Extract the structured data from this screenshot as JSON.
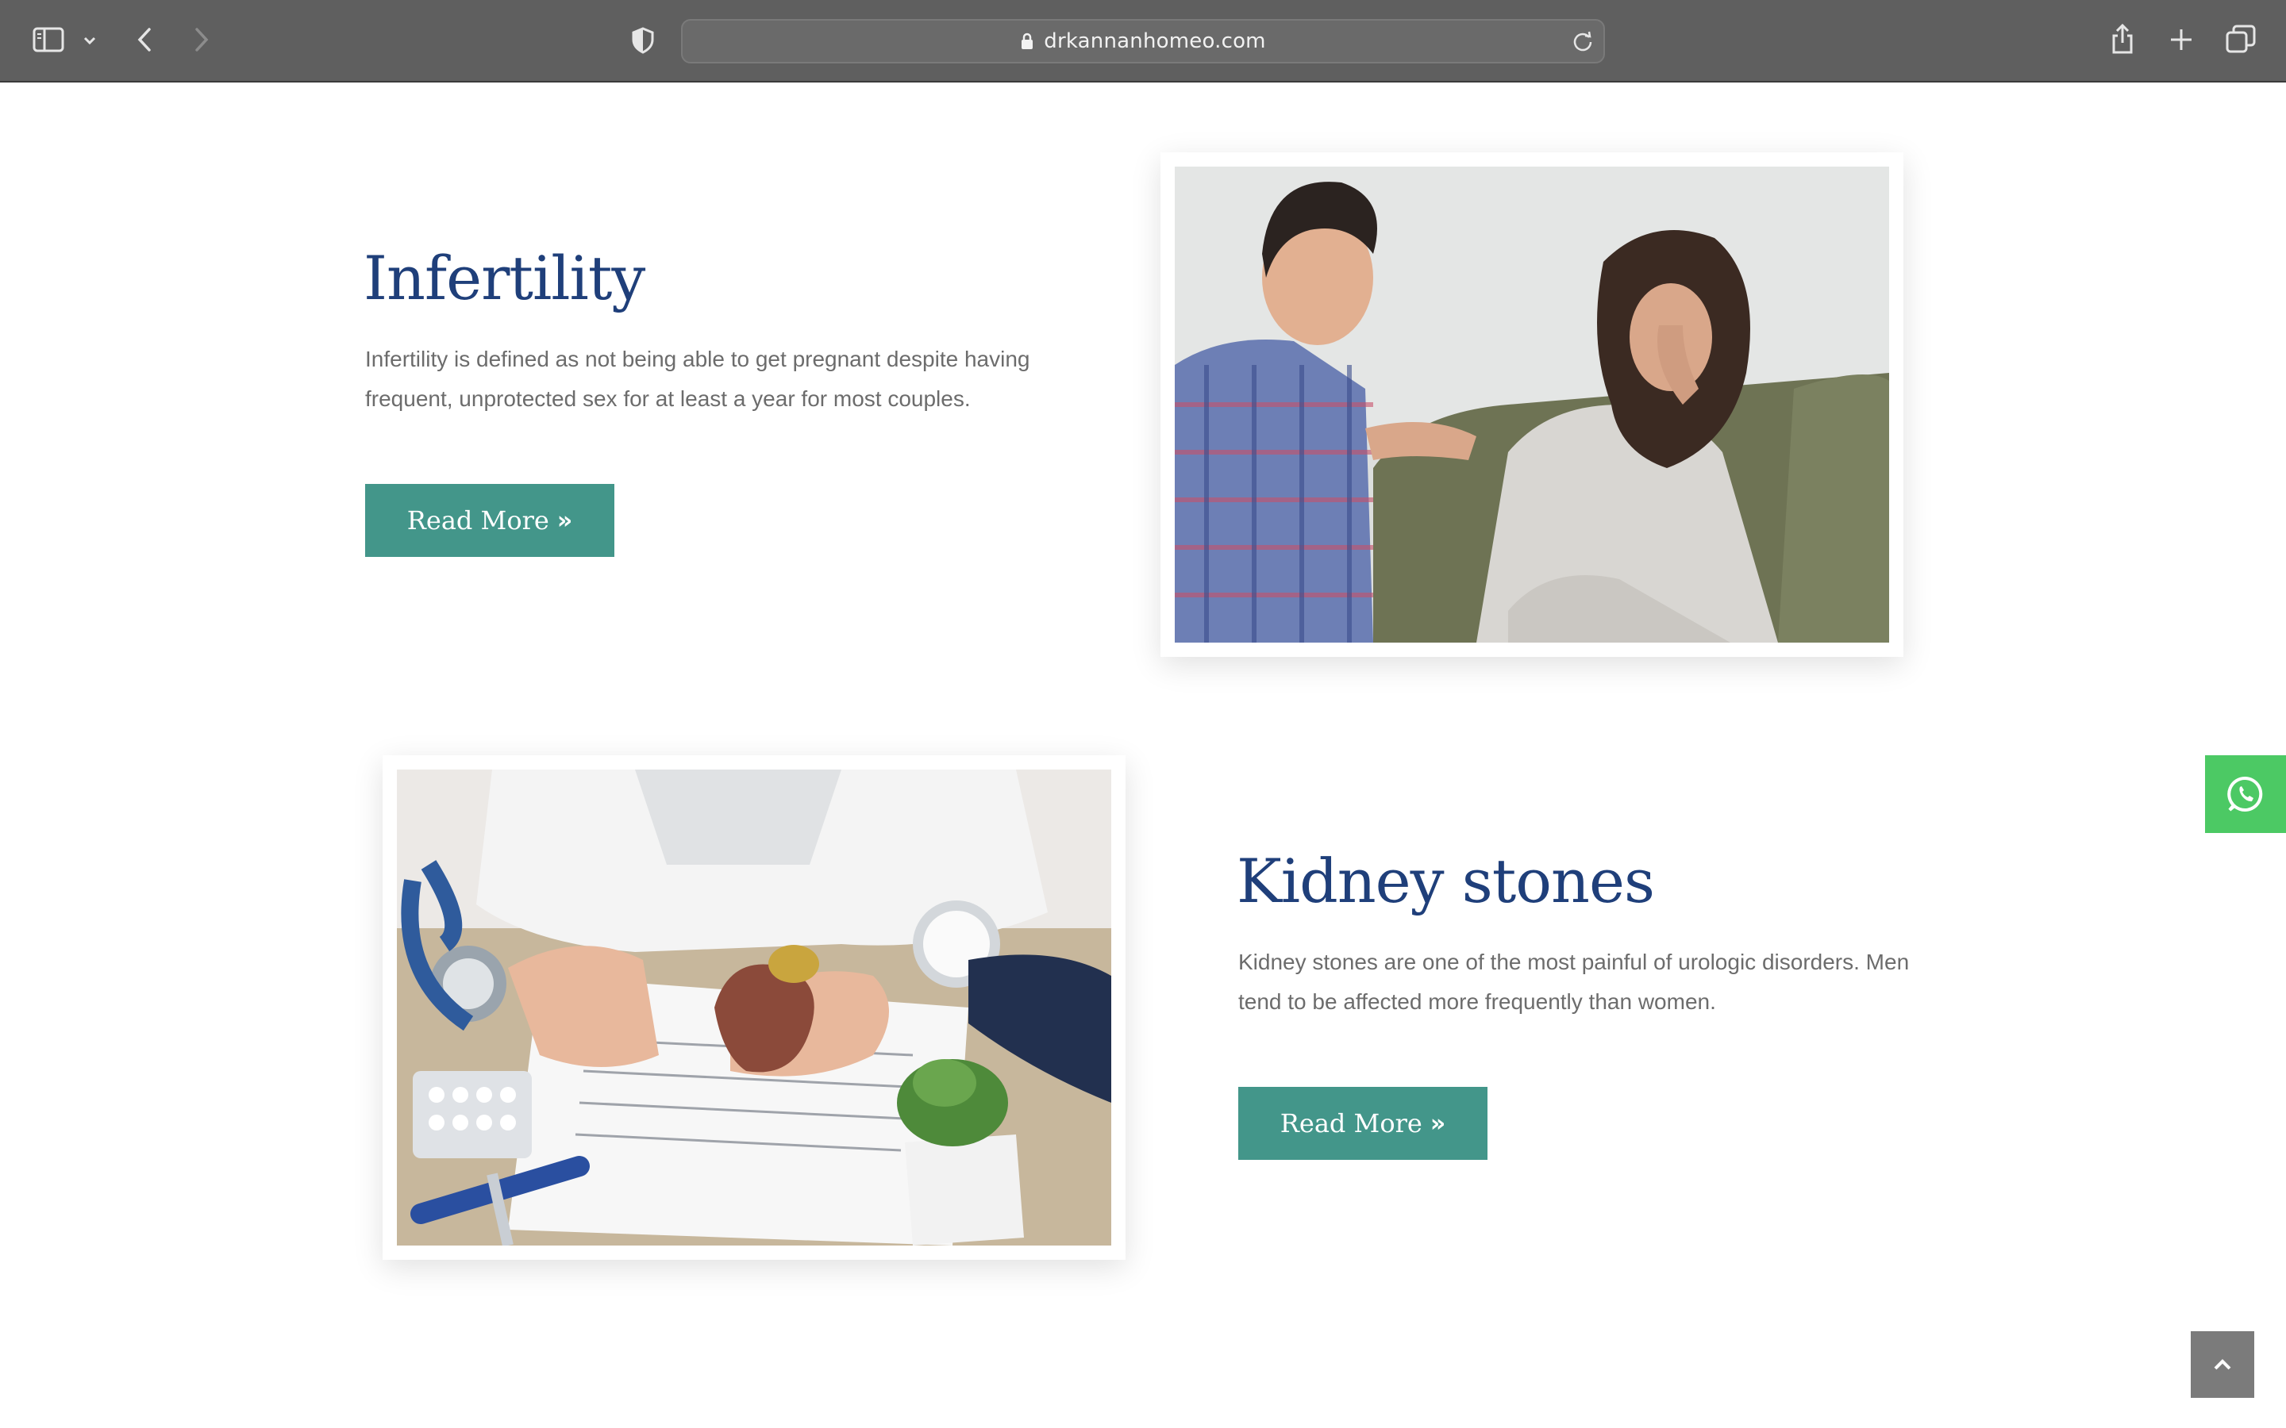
{
  "browser": {
    "url": "drkannanhomeo.com",
    "icons": {
      "sidebar": "sidebar-icon",
      "chevron": "chevron-down-icon",
      "back": "back-arrow-icon",
      "forward": "forward-arrow-icon",
      "shield": "privacy-shield-icon",
      "lock": "lock-icon",
      "reload": "reload-icon",
      "share": "share-icon",
      "new_tab": "plus-icon",
      "tabs": "tabs-overview-icon"
    }
  },
  "sections": [
    {
      "title": "Infertility",
      "description": "Infertility is defined as not being able to get pregnant despite having frequent, unprotected sex for at least a year for most couples.",
      "button_label": "Read More",
      "image_alt": "couple-consoling-photo"
    },
    {
      "title": "Kidney stones",
      "description": "Kidney stones are one of the most painful of urologic disorders. Men tend to be affected more frequently than women.",
      "button_label": "Read More",
      "image_alt": "doctor-kidney-model-photo"
    }
  ],
  "colors": {
    "heading": "#1f3f7a",
    "button": "#43968a",
    "whatsapp": "#4cc964",
    "scroll_top": "#7b7b7b"
  },
  "widgets": {
    "whatsapp_icon": "whatsapp-icon",
    "scroll_top_icon": "chevron-up-icon"
  }
}
